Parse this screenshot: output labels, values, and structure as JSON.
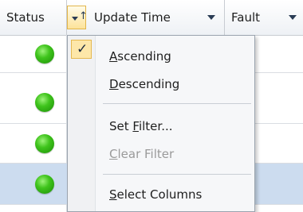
{
  "header": {
    "columns": [
      {
        "label": "Status"
      },
      {
        "label": "Update Time"
      },
      {
        "label": "Fault"
      }
    ],
    "sort_indicator": "↑"
  },
  "rows": [
    {
      "status": "ok"
    },
    {
      "status": "ok"
    },
    {
      "status": "ok"
    },
    {
      "status": "ok",
      "selected": true
    }
  ],
  "menu": {
    "check": "✓",
    "items": [
      {
        "pre": "",
        "key": "A",
        "post": "scending",
        "checked": true,
        "enabled": true
      },
      {
        "pre": "",
        "key": "D",
        "post": "escending",
        "checked": false,
        "enabled": true
      },
      {
        "pre": "Set ",
        "key": "F",
        "post": "ilter...",
        "checked": false,
        "enabled": true
      },
      {
        "pre": "",
        "key": "C",
        "post": "lear Filter",
        "checked": false,
        "enabled": false
      },
      {
        "pre": "",
        "key": "S",
        "post": "elect Columns",
        "checked": false,
        "enabled": true
      }
    ]
  },
  "colors": {
    "status_ok": "#2fb515",
    "selected_row": "#ccdcef",
    "check_highlight": "#fde7a9"
  }
}
